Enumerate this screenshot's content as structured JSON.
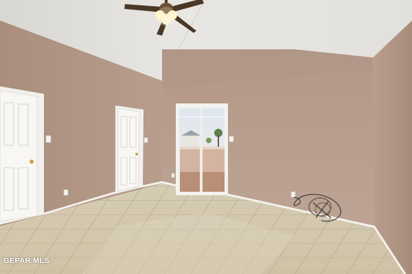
{
  "photo": {
    "watermark": "GEPAR MLS"
  },
  "colors": {
    "wall": "#b79b8a",
    "ceiling": "#e4e2de",
    "floor_tile": "#d8ccb2",
    "trim": "#f6f5f1",
    "watermark": "#ffffff"
  }
}
